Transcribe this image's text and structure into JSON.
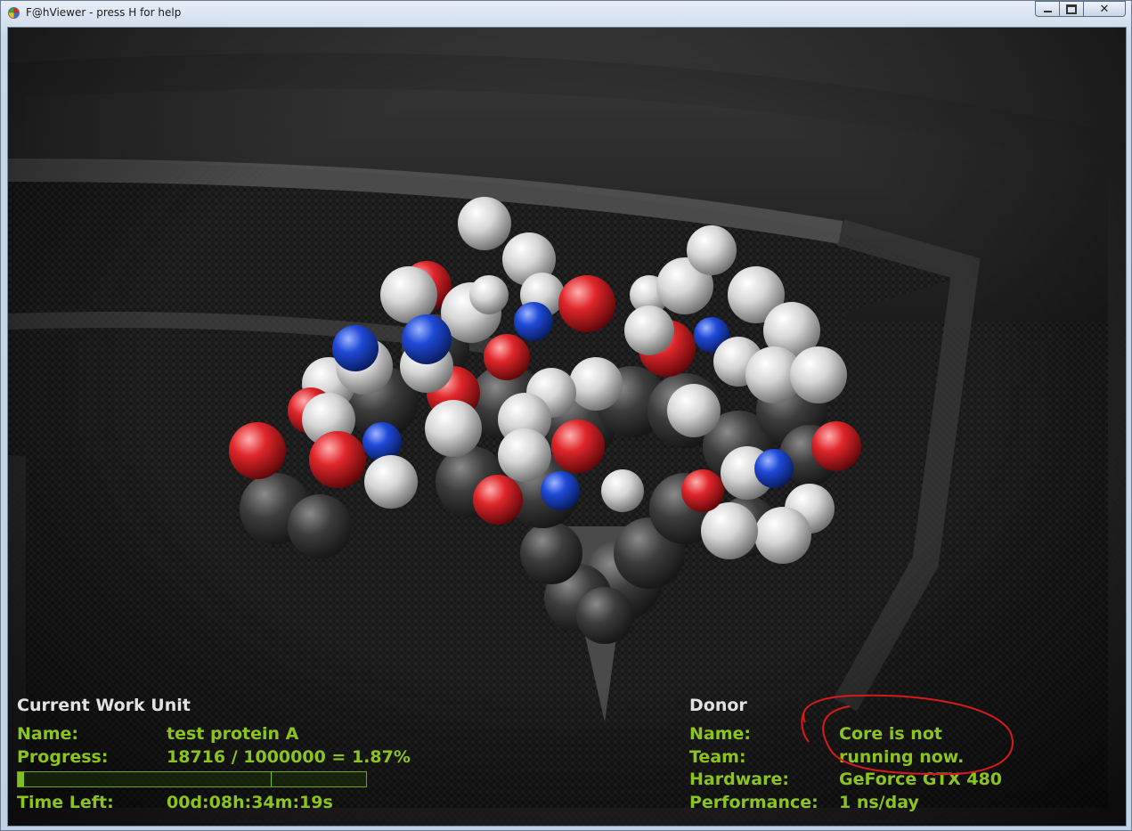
{
  "window": {
    "title": "F@hViewer - press H for help",
    "close_glyph": "✕"
  },
  "work_unit": {
    "heading": "Current Work Unit",
    "name_label": "Name:",
    "name_value": "test protein A",
    "progress_label": "Progress:",
    "progress_value": "18716 / 1000000 = 1.87%",
    "progress_fraction": 0.0187,
    "time_label": "Time Left:",
    "time_value": "00d:08h:34m:19s"
  },
  "donor": {
    "heading": "Donor",
    "name_label": "Name:",
    "name_value": "Core is not",
    "team_label": "Team:",
    "team_value": "running now.",
    "hardware_label": "Hardware:",
    "hardware_value": "GeForce GTX 480",
    "performance_label": "Performance:",
    "performance_value": "1 ns/day"
  },
  "colors": {
    "hud_green": "#8cc41e",
    "hud_heading": "#e2e2e2",
    "atom_white": "#e6e6e6",
    "atom_red": "#e0262a",
    "atom_blue": "#1f49d8",
    "atom_gray": "#3c3c3c",
    "annotation_red": "#d81a1a"
  }
}
